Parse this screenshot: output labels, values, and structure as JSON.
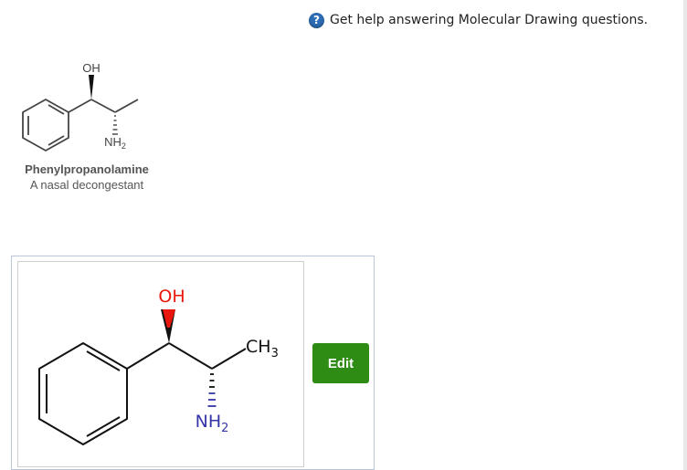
{
  "help": {
    "icon": "question-circle-icon",
    "icon_glyph": "?",
    "text": "Get help answering Molecular Drawing questions."
  },
  "reference": {
    "oh_label": "OH",
    "nh2_label": "NH",
    "nh2_sub": "2",
    "name": "Phenylpropanolamine",
    "description": "A nasal decongestant"
  },
  "drawing": {
    "oh_label": "OH",
    "ch3_label": "CH",
    "ch3_sub": "3",
    "nh2_label": "NH",
    "nh2_sub": "2",
    "oh_color": "#e8160c",
    "nh2_color": "#3535a8"
  },
  "edit_button": {
    "label": "Edit",
    "color": "#2e8b14"
  }
}
